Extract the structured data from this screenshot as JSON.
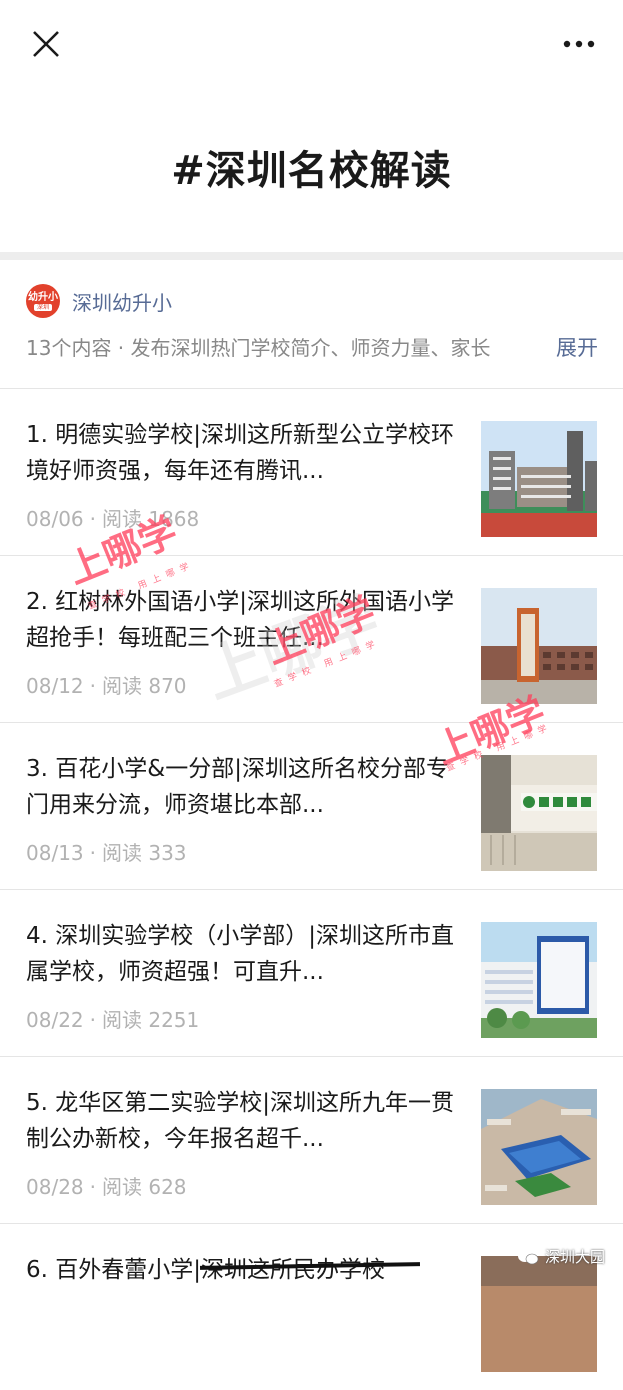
{
  "header": {
    "title": "#深圳名校解读"
  },
  "account": {
    "avatar_text": "幼升小",
    "avatar_sub": "深圳",
    "name": "深圳幼升小"
  },
  "description": {
    "text": "13个内容 · 发布深圳热门学校简介、师资力量、家长",
    "expand_label": "展开"
  },
  "articles": [
    {
      "title": "1. 明德实验学校|深圳这所新型公立学校环境好师资强，每年还有腾讯...",
      "date": "08/06",
      "reads": "阅读 1868"
    },
    {
      "title": "2. 红树林外国语小学|深圳这所外国语小学超抢手！每班配三个班主任...",
      "date": "08/12",
      "reads": "阅读 870"
    },
    {
      "title": "3. 百花小学&一分部|深圳这所名校分部专门用来分流，师资堪比本部...",
      "date": "08/13",
      "reads": "阅读 333"
    },
    {
      "title": "4. 深圳实验学校（小学部）|深圳这所市直属学校，师资超强！可直升...",
      "date": "08/22",
      "reads": "阅读 2251"
    },
    {
      "title": "5. 龙华区第二实验学校|深圳这所九年一贯制公办新校，今年报名超千...",
      "date": "08/28",
      "reads": "阅读 628"
    },
    {
      "title": "6. 百外春蕾小学|深圳这所民办学校",
      "date": "",
      "reads": ""
    }
  ],
  "watermarks": {
    "main": "上哪学",
    "sub": "查学校 用上哪学"
  },
  "footer_badge": {
    "text": "深圳大园"
  },
  "colors": {
    "link": "#576b95",
    "avatar": "#e2412c",
    "watermark": "#ff3d5a"
  }
}
